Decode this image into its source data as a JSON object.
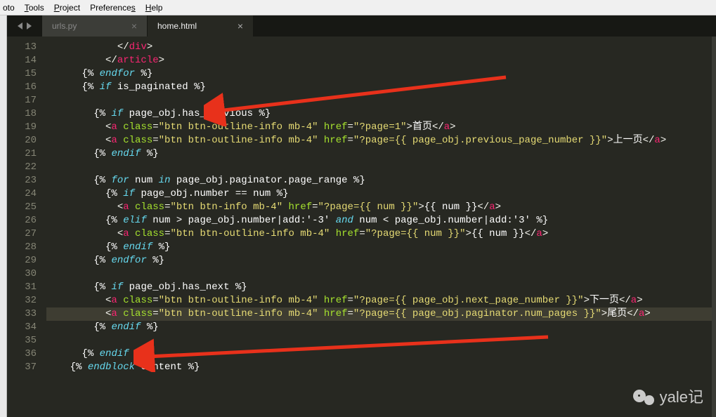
{
  "menu": {
    "items": [
      "oto",
      "Tools",
      "Project",
      "Preferences",
      "Help"
    ]
  },
  "tabs": {
    "inactive": {
      "label": "urls.py"
    },
    "active": {
      "label": "home.html"
    }
  },
  "watermark": "yale记",
  "code_lines": [
    {
      "n": 13,
      "indent": 12,
      "tokens": [
        {
          "t": "punc",
          "v": "</"
        },
        {
          "t": "tag",
          "v": "div"
        },
        {
          "t": "punc",
          "v": ">"
        }
      ]
    },
    {
      "n": 14,
      "indent": 10,
      "tokens": [
        {
          "t": "punc",
          "v": "</"
        },
        {
          "t": "tag",
          "v": "article"
        },
        {
          "t": "punc",
          "v": ">"
        }
      ]
    },
    {
      "n": 15,
      "indent": 6,
      "tokens": [
        {
          "t": "txt",
          "v": "{% "
        },
        {
          "t": "kw",
          "v": "endfor"
        },
        {
          "t": "txt",
          "v": " %}"
        }
      ]
    },
    {
      "n": 16,
      "indent": 6,
      "tokens": [
        {
          "t": "txt",
          "v": "{% "
        },
        {
          "t": "kw",
          "v": "if"
        },
        {
          "t": "txt",
          "v": " is_paginated %}"
        }
      ]
    },
    {
      "n": 17,
      "indent": 0,
      "tokens": []
    },
    {
      "n": 18,
      "indent": 8,
      "tokens": [
        {
          "t": "txt",
          "v": "{% "
        },
        {
          "t": "kw",
          "v": "if"
        },
        {
          "t": "txt",
          "v": " page_obj.has_previous %}"
        }
      ]
    },
    {
      "n": 19,
      "indent": 10,
      "tokens": [
        {
          "t": "punc",
          "v": "<"
        },
        {
          "t": "tag",
          "v": "a"
        },
        {
          "t": "punc",
          "v": " "
        },
        {
          "t": "attr",
          "v": "class"
        },
        {
          "t": "punc",
          "v": "="
        },
        {
          "t": "str",
          "v": "\"btn btn-outline-info mb-4\""
        },
        {
          "t": "punc",
          "v": " "
        },
        {
          "t": "attr",
          "v": "href"
        },
        {
          "t": "punc",
          "v": "="
        },
        {
          "t": "str",
          "v": "\"?page=1\""
        },
        {
          "t": "punc",
          "v": ">"
        },
        {
          "t": "txt",
          "v": "首页"
        },
        {
          "t": "punc",
          "v": "</"
        },
        {
          "t": "tag",
          "v": "a"
        },
        {
          "t": "punc",
          "v": ">"
        }
      ]
    },
    {
      "n": 20,
      "indent": 10,
      "tokens": [
        {
          "t": "punc",
          "v": "<"
        },
        {
          "t": "tag",
          "v": "a"
        },
        {
          "t": "punc",
          "v": " "
        },
        {
          "t": "attr",
          "v": "class"
        },
        {
          "t": "punc",
          "v": "="
        },
        {
          "t": "str",
          "v": "\"btn btn-outline-info mb-4\""
        },
        {
          "t": "punc",
          "v": " "
        },
        {
          "t": "attr",
          "v": "href"
        },
        {
          "t": "punc",
          "v": "="
        },
        {
          "t": "str",
          "v": "\"?page={{ page_obj.previous_page_number }}\""
        },
        {
          "t": "punc",
          "v": ">"
        },
        {
          "t": "txt",
          "v": "上一页"
        },
        {
          "t": "punc",
          "v": "</"
        },
        {
          "t": "tag",
          "v": "a"
        },
        {
          "t": "punc",
          "v": ">"
        }
      ]
    },
    {
      "n": 21,
      "indent": 8,
      "tokens": [
        {
          "t": "txt",
          "v": "{% "
        },
        {
          "t": "kw",
          "v": "endif"
        },
        {
          "t": "txt",
          "v": " %}"
        }
      ]
    },
    {
      "n": 22,
      "indent": 0,
      "tokens": []
    },
    {
      "n": 23,
      "indent": 8,
      "tokens": [
        {
          "t": "txt",
          "v": "{% "
        },
        {
          "t": "kw",
          "v": "for"
        },
        {
          "t": "txt",
          "v": " num "
        },
        {
          "t": "kw",
          "v": "in"
        },
        {
          "t": "txt",
          "v": " page_obj.paginator.page_range %}"
        }
      ]
    },
    {
      "n": 24,
      "indent": 10,
      "tokens": [
        {
          "t": "txt",
          "v": "{% "
        },
        {
          "t": "kw",
          "v": "if"
        },
        {
          "t": "txt",
          "v": " page_obj.number == num %}"
        }
      ]
    },
    {
      "n": 25,
      "indent": 12,
      "tokens": [
        {
          "t": "punc",
          "v": "<"
        },
        {
          "t": "tag",
          "v": "a"
        },
        {
          "t": "punc",
          "v": " "
        },
        {
          "t": "attr",
          "v": "class"
        },
        {
          "t": "punc",
          "v": "="
        },
        {
          "t": "str",
          "v": "\"btn btn-info mb-4\""
        },
        {
          "t": "punc",
          "v": " "
        },
        {
          "t": "attr",
          "v": "href"
        },
        {
          "t": "punc",
          "v": "="
        },
        {
          "t": "str",
          "v": "\"?page={{ num }}\""
        },
        {
          "t": "punc",
          "v": ">"
        },
        {
          "t": "txt",
          "v": "{{ num }}"
        },
        {
          "t": "punc",
          "v": "</"
        },
        {
          "t": "tag",
          "v": "a"
        },
        {
          "t": "punc",
          "v": ">"
        }
      ]
    },
    {
      "n": 26,
      "indent": 10,
      "tokens": [
        {
          "t": "txt",
          "v": "{% "
        },
        {
          "t": "kw",
          "v": "elif"
        },
        {
          "t": "txt",
          "v": " num > page_obj.number|add:'-3' "
        },
        {
          "t": "kw",
          "v": "and"
        },
        {
          "t": "txt",
          "v": " num < page_obj.number|add:'3' %}"
        }
      ]
    },
    {
      "n": 27,
      "indent": 12,
      "tokens": [
        {
          "t": "punc",
          "v": "<"
        },
        {
          "t": "tag",
          "v": "a"
        },
        {
          "t": "punc",
          "v": " "
        },
        {
          "t": "attr",
          "v": "class"
        },
        {
          "t": "punc",
          "v": "="
        },
        {
          "t": "str",
          "v": "\"btn btn-outline-info mb-4\""
        },
        {
          "t": "punc",
          "v": " "
        },
        {
          "t": "attr",
          "v": "href"
        },
        {
          "t": "punc",
          "v": "="
        },
        {
          "t": "str",
          "v": "\"?page={{ num }}\""
        },
        {
          "t": "punc",
          "v": ">"
        },
        {
          "t": "txt",
          "v": "{{ num }}"
        },
        {
          "t": "punc",
          "v": "</"
        },
        {
          "t": "tag",
          "v": "a"
        },
        {
          "t": "punc",
          "v": ">"
        }
      ]
    },
    {
      "n": 28,
      "indent": 10,
      "tokens": [
        {
          "t": "txt",
          "v": "{% "
        },
        {
          "t": "kw",
          "v": "endif"
        },
        {
          "t": "txt",
          "v": " %}"
        }
      ]
    },
    {
      "n": 29,
      "indent": 8,
      "tokens": [
        {
          "t": "txt",
          "v": "{% "
        },
        {
          "t": "kw",
          "v": "endfor"
        },
        {
          "t": "txt",
          "v": " %}"
        }
      ]
    },
    {
      "n": 30,
      "indent": 0,
      "tokens": []
    },
    {
      "n": 31,
      "indent": 8,
      "tokens": [
        {
          "t": "txt",
          "v": "{% "
        },
        {
          "t": "kw",
          "v": "if"
        },
        {
          "t": "txt",
          "v": " page_obj.has_next %}"
        }
      ]
    },
    {
      "n": 32,
      "indent": 10,
      "tokens": [
        {
          "t": "punc",
          "v": "<"
        },
        {
          "t": "tag",
          "v": "a"
        },
        {
          "t": "punc",
          "v": " "
        },
        {
          "t": "attr",
          "v": "class"
        },
        {
          "t": "punc",
          "v": "="
        },
        {
          "t": "str",
          "v": "\"btn btn-outline-info mb-4\""
        },
        {
          "t": "punc",
          "v": " "
        },
        {
          "t": "attr",
          "v": "href"
        },
        {
          "t": "punc",
          "v": "="
        },
        {
          "t": "str",
          "v": "\"?page={{ page_obj.next_page_number }}\""
        },
        {
          "t": "punc",
          "v": ">"
        },
        {
          "t": "txt",
          "v": "下一页"
        },
        {
          "t": "punc",
          "v": "</"
        },
        {
          "t": "tag",
          "v": "a"
        },
        {
          "t": "punc",
          "v": ">"
        }
      ]
    },
    {
      "n": 33,
      "indent": 10,
      "hl": true,
      "tokens": [
        {
          "t": "punc",
          "v": "<"
        },
        {
          "t": "tag",
          "v": "a"
        },
        {
          "t": "punc",
          "v": " "
        },
        {
          "t": "attr",
          "v": "class"
        },
        {
          "t": "punc",
          "v": "="
        },
        {
          "t": "str",
          "v": "\"btn btn-outline-info mb-4\""
        },
        {
          "t": "punc",
          "v": " "
        },
        {
          "t": "attr",
          "v": "href"
        },
        {
          "t": "punc",
          "v": "="
        },
        {
          "t": "str",
          "v": "\"?page={{ page_obj.paginator.num_pages }}\""
        },
        {
          "t": "punc",
          "v": ">"
        },
        {
          "t": "txt",
          "v": "尾页"
        },
        {
          "t": "punc",
          "v": "</"
        },
        {
          "t": "tag",
          "v": "a"
        },
        {
          "t": "punc",
          "v": ">"
        }
      ]
    },
    {
      "n": 34,
      "indent": 8,
      "tokens": [
        {
          "t": "txt",
          "v": "{% "
        },
        {
          "t": "kw",
          "v": "endif"
        },
        {
          "t": "txt",
          "v": " %}"
        }
      ]
    },
    {
      "n": 35,
      "indent": 0,
      "tokens": []
    },
    {
      "n": 36,
      "indent": 6,
      "tokens": [
        {
          "t": "txt",
          "v": "{% "
        },
        {
          "t": "kw",
          "v": "endif"
        },
        {
          "t": "txt",
          "v": " %}"
        }
      ]
    },
    {
      "n": 37,
      "indent": 4,
      "tokens": [
        {
          "t": "txt",
          "v": "{% "
        },
        {
          "t": "kw",
          "v": "endblock"
        },
        {
          "t": "txt",
          "v": " content %}"
        }
      ]
    }
  ]
}
